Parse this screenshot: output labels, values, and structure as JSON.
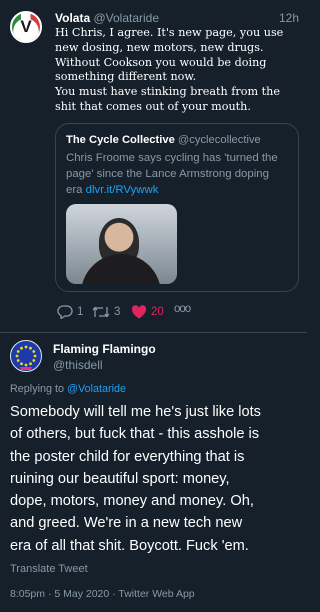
{
  "tweet1": {
    "name": "Volata",
    "handle": "@Volataride",
    "time": "12h",
    "avatar_text": "V",
    "lines": [
      "Hi Chris, I agree. It's new page, you use",
      "new dosing, new motors, new drugs.",
      "Without Cookson you would be doing",
      "something different now.",
      "You must have stinking breath from the",
      "shit that comes out of your mouth."
    ],
    "quote": {
      "name": "The Cycle Collective",
      "handle": "@cyclecollective",
      "lines": [
        "Chris Froome says cycling has 'turned the",
        "page' since the Lance Armstrong doping"
      ],
      "last_text": "era ",
      "link": "dlvr.it/RVywwk"
    },
    "actions": {
      "reply_count": "1",
      "retweet_count": "3",
      "like_count": "20",
      "more": "ooo"
    },
    "colors": {
      "like": "#e0245e",
      "link": "#1da1f2"
    }
  },
  "tweet2": {
    "name": "Flaming Flamingo",
    "handle": "@thisdell",
    "avatar_icon": "eu-flag-avatar",
    "reply_prefix": "Replying to ",
    "reply_to": "@Volataride",
    "lines": [
      "Somebody will tell me he's just like lots",
      "of others, but fuck that - this asshole is",
      "the poster child for everything that is",
      "ruining our beautiful sport: money,",
      "dope, motors, money and money. Oh,",
      "and greed. We're in a new tech new",
      "era of all that shit. Boycott. Fuck 'em."
    ],
    "translate": "Translate Tweet",
    "meta": "8:05pm · 5 May 2020 · Twitter Web App"
  }
}
